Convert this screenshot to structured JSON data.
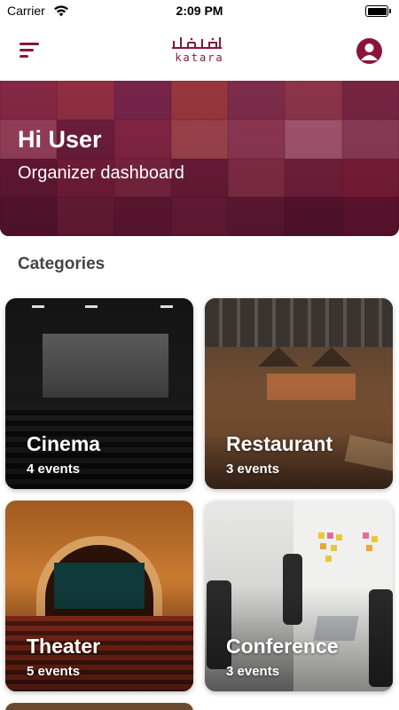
{
  "status_bar": {
    "carrier": "Carrier",
    "time": "2:09 PM"
  },
  "header": {
    "logo_text": "katara",
    "menu_icon": "menu-icon",
    "profile_icon": "profile-icon"
  },
  "hero": {
    "title": "Hi User",
    "subtitle": "Organizer dashboard"
  },
  "categories": {
    "title": "Categories",
    "items": [
      {
        "name": "Cinema",
        "count": "4 events"
      },
      {
        "name": "Restaurant",
        "count": "3 events"
      },
      {
        "name": "Theater",
        "count": "5 events"
      },
      {
        "name": "Conference",
        "count": "3 events"
      }
    ]
  },
  "colors": {
    "brand": "#8a1538",
    "background": "#ffffff",
    "heading": "#444444"
  }
}
